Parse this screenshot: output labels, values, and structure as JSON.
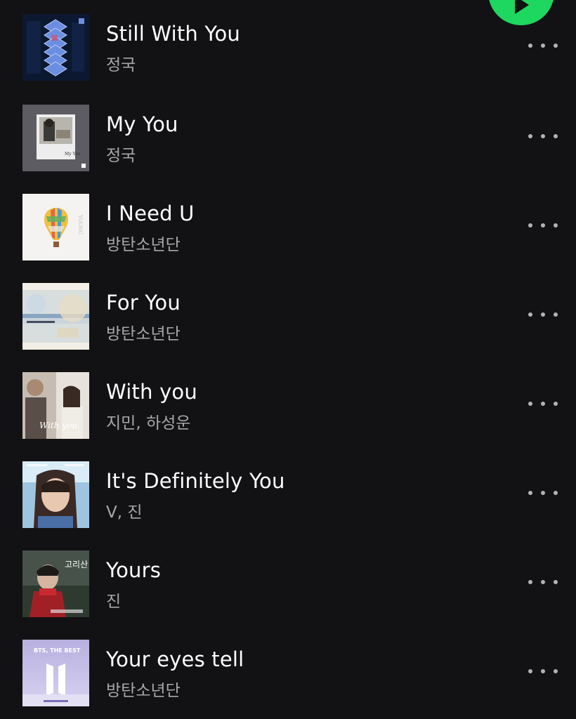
{
  "player": {
    "play_icon": "play-icon",
    "accent_color": "#1ed760"
  },
  "tracks": [
    {
      "title": "Still With You",
      "artist": "정국",
      "menu_icon": "more-options-icon"
    },
    {
      "title": "My You",
      "artist": "정국",
      "menu_icon": "more-options-icon"
    },
    {
      "title": "I Need U",
      "artist": "방탄소년단",
      "menu_icon": "more-options-icon"
    },
    {
      "title": "For You",
      "artist": "방탄소년단",
      "menu_icon": "more-options-icon"
    },
    {
      "title": "With you",
      "artist": "지민, 하성운",
      "menu_icon": "more-options-icon"
    },
    {
      "title": "It's Definitely You",
      "artist": "V, 진",
      "menu_icon": "more-options-icon"
    },
    {
      "title": "Yours",
      "artist": "진",
      "menu_icon": "more-options-icon"
    },
    {
      "title": "Your eyes tell",
      "artist": "방탄소년단",
      "menu_icon": "more-options-icon"
    }
  ]
}
